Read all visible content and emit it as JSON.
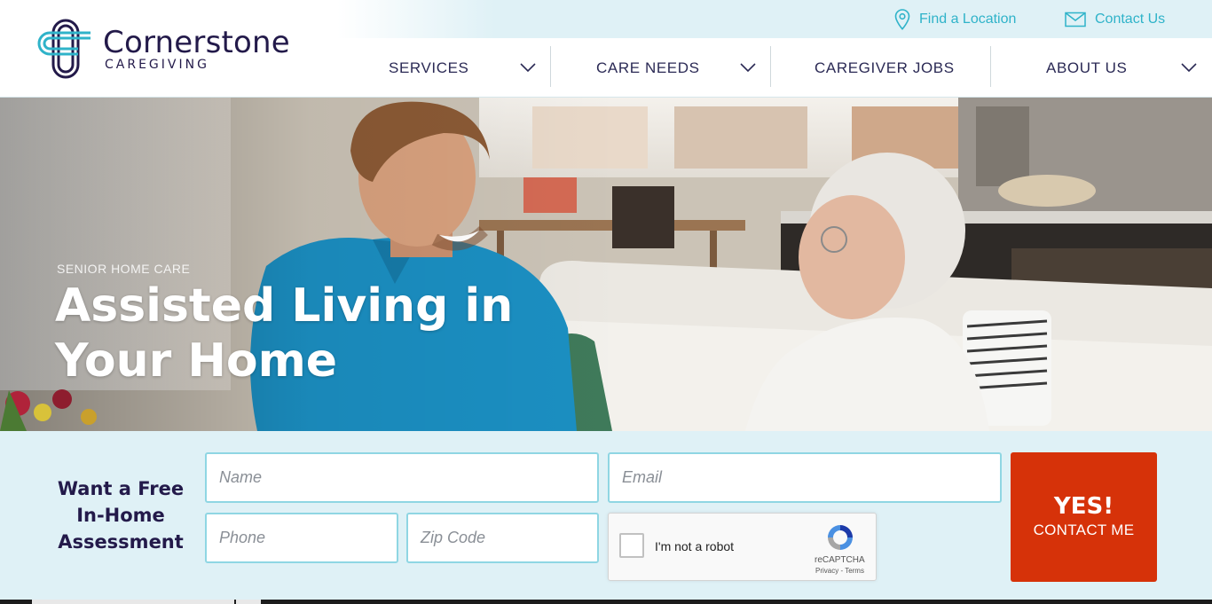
{
  "brand": {
    "name": "Cornerstone",
    "tagline": "CAREGIVING",
    "colors": {
      "navy": "#231a4a",
      "teal": "#2fb3c9",
      "cta": "#d63209",
      "band": "#dff1f6"
    }
  },
  "utility": {
    "find_location": {
      "label": "Find a Location",
      "icon": "map-pin-icon"
    },
    "contact_us": {
      "label": "Contact Us",
      "icon": "envelope-icon"
    }
  },
  "nav": {
    "items": [
      {
        "label": "SERVICES",
        "has_dropdown": true
      },
      {
        "label": "CARE NEEDS",
        "has_dropdown": true
      },
      {
        "label": "CAREGIVER JOBS",
        "has_dropdown": false
      },
      {
        "label": "ABOUT US",
        "has_dropdown": true
      }
    ]
  },
  "hero": {
    "kicker": "SENIOR HOME CARE",
    "title": "Assisted Living in Your Home"
  },
  "form": {
    "heading": "Want a Free In-Home Assessment",
    "name_placeholder": "Name",
    "email_placeholder": "Email",
    "phone_placeholder": "Phone",
    "zip_placeholder": "Zip Code",
    "recaptcha": {
      "label": "I'm not a robot",
      "brand": "reCAPTCHA",
      "terms": "Privacy - Terms"
    },
    "submit": {
      "line1": "YES!",
      "line2": "CONTACT ME"
    }
  }
}
